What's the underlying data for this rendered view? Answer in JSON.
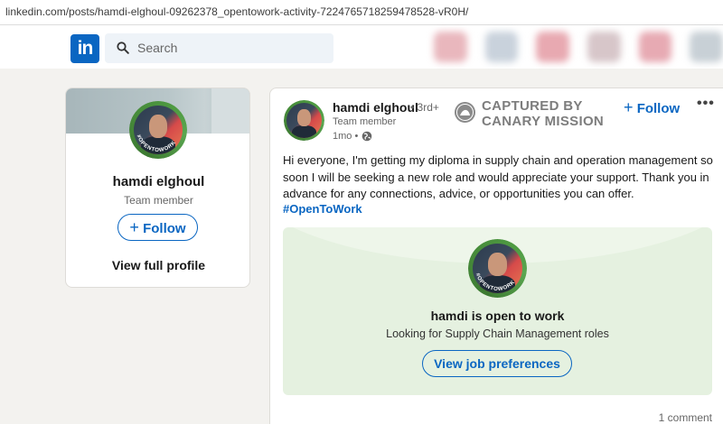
{
  "browser": {
    "url": "linkedin.com/posts/hamdi-elghoul-09262378_opentowork-activity-7224765718259478528-vR0H/"
  },
  "nav": {
    "logo_text": "in",
    "search_placeholder": "Search",
    "search_icon": "search-icon",
    "blurred_icon_colors": [
      "#e9b7bd",
      "#c9d2dc",
      "#e8a9b1",
      "#d7c6c9",
      "#e7aab3",
      "#c8d0d6"
    ]
  },
  "profile_card": {
    "name": "hamdi elghoul",
    "role": "Team member",
    "follow_label": "Follow",
    "view_profile_label": "View full profile",
    "open_to_work_badge": "#OPENTOWORK"
  },
  "post": {
    "author": "hamdi elghoul",
    "degree": "• 3rd+",
    "role": "Team member",
    "time": "1mo •",
    "visibility_icon": "globe-icon",
    "watermark": "CAPTURED BY CANARY MISSION",
    "follow_label": "Follow",
    "more_icon": "more-icon",
    "text": "Hi everyone, I'm getting my diploma in supply chain and operation management so soon I will be seeking a new role and would appreciate your support. Thank you in advance for any connections, advice, or opportunities you can offer.",
    "hashtag": "#OpenToWork",
    "open_to_work": {
      "title": "hamdi is open to work",
      "subtitle": "Looking for Supply Chain Management roles",
      "button_label": "View job preferences"
    },
    "comments_count": "1 comment"
  },
  "colors": {
    "linkedin_blue": "#0a66c2",
    "open_to_work_green": "#4f9b42",
    "page_background": "#f3f2ef"
  }
}
